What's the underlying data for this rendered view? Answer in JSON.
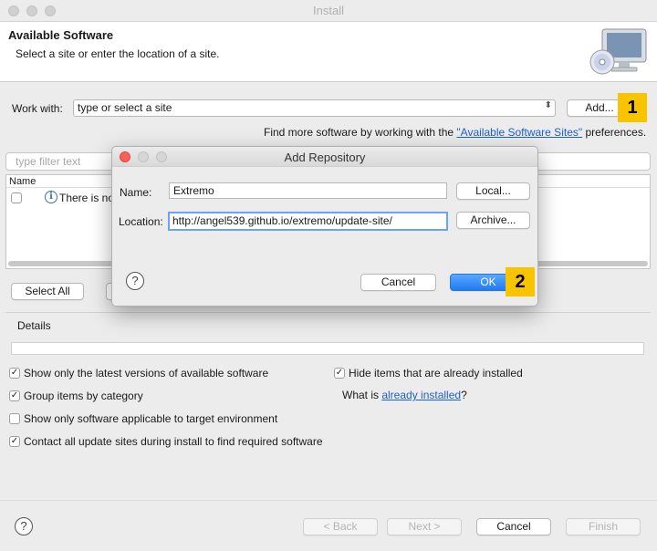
{
  "window": {
    "title": "Install"
  },
  "banner": {
    "heading": "Available Software",
    "subtitle": "Select a site or enter the location of a site."
  },
  "work_with": {
    "label": "Work with:",
    "placeholder": "type or select a site",
    "add_button": "Add...",
    "hint_prefix": "Find more software by working with the ",
    "hint_link": "\"Available Software Sites\"",
    "hint_suffix": " preferences."
  },
  "filter": {
    "placeholder": "type filter text"
  },
  "table": {
    "column_name": "Name",
    "info_text": "There is no"
  },
  "select_all": "Select All",
  "details": {
    "label": "Details"
  },
  "options": {
    "latest_versions": "Show only the latest versions of available software",
    "group_by_category": "Group items by category",
    "target_env": "Show only software applicable to target environment",
    "contact_sites": "Contact all update sites during install to find required software",
    "hide_installed": "Hide items that are already installed",
    "what_is_prefix": "What is ",
    "what_is_link": "already installed",
    "what_is_suffix": "?"
  },
  "footer": {
    "back": "< Back",
    "next": "Next >",
    "cancel": "Cancel",
    "finish": "Finish"
  },
  "dialog": {
    "title": "Add Repository",
    "name_label": "Name:",
    "name_value": "Extremo",
    "location_label": "Location:",
    "location_value": "http://angel539.github.io/extremo/update-site/",
    "local_button": "Local...",
    "archive_button": "Archive...",
    "cancel_button": "Cancel",
    "ok_button": "OK"
  },
  "callouts": {
    "first": "1",
    "second": "2"
  },
  "colors": {
    "callout": "#f8c400",
    "link": "#1b5fd1",
    "ok": "#1f7bf2"
  }
}
